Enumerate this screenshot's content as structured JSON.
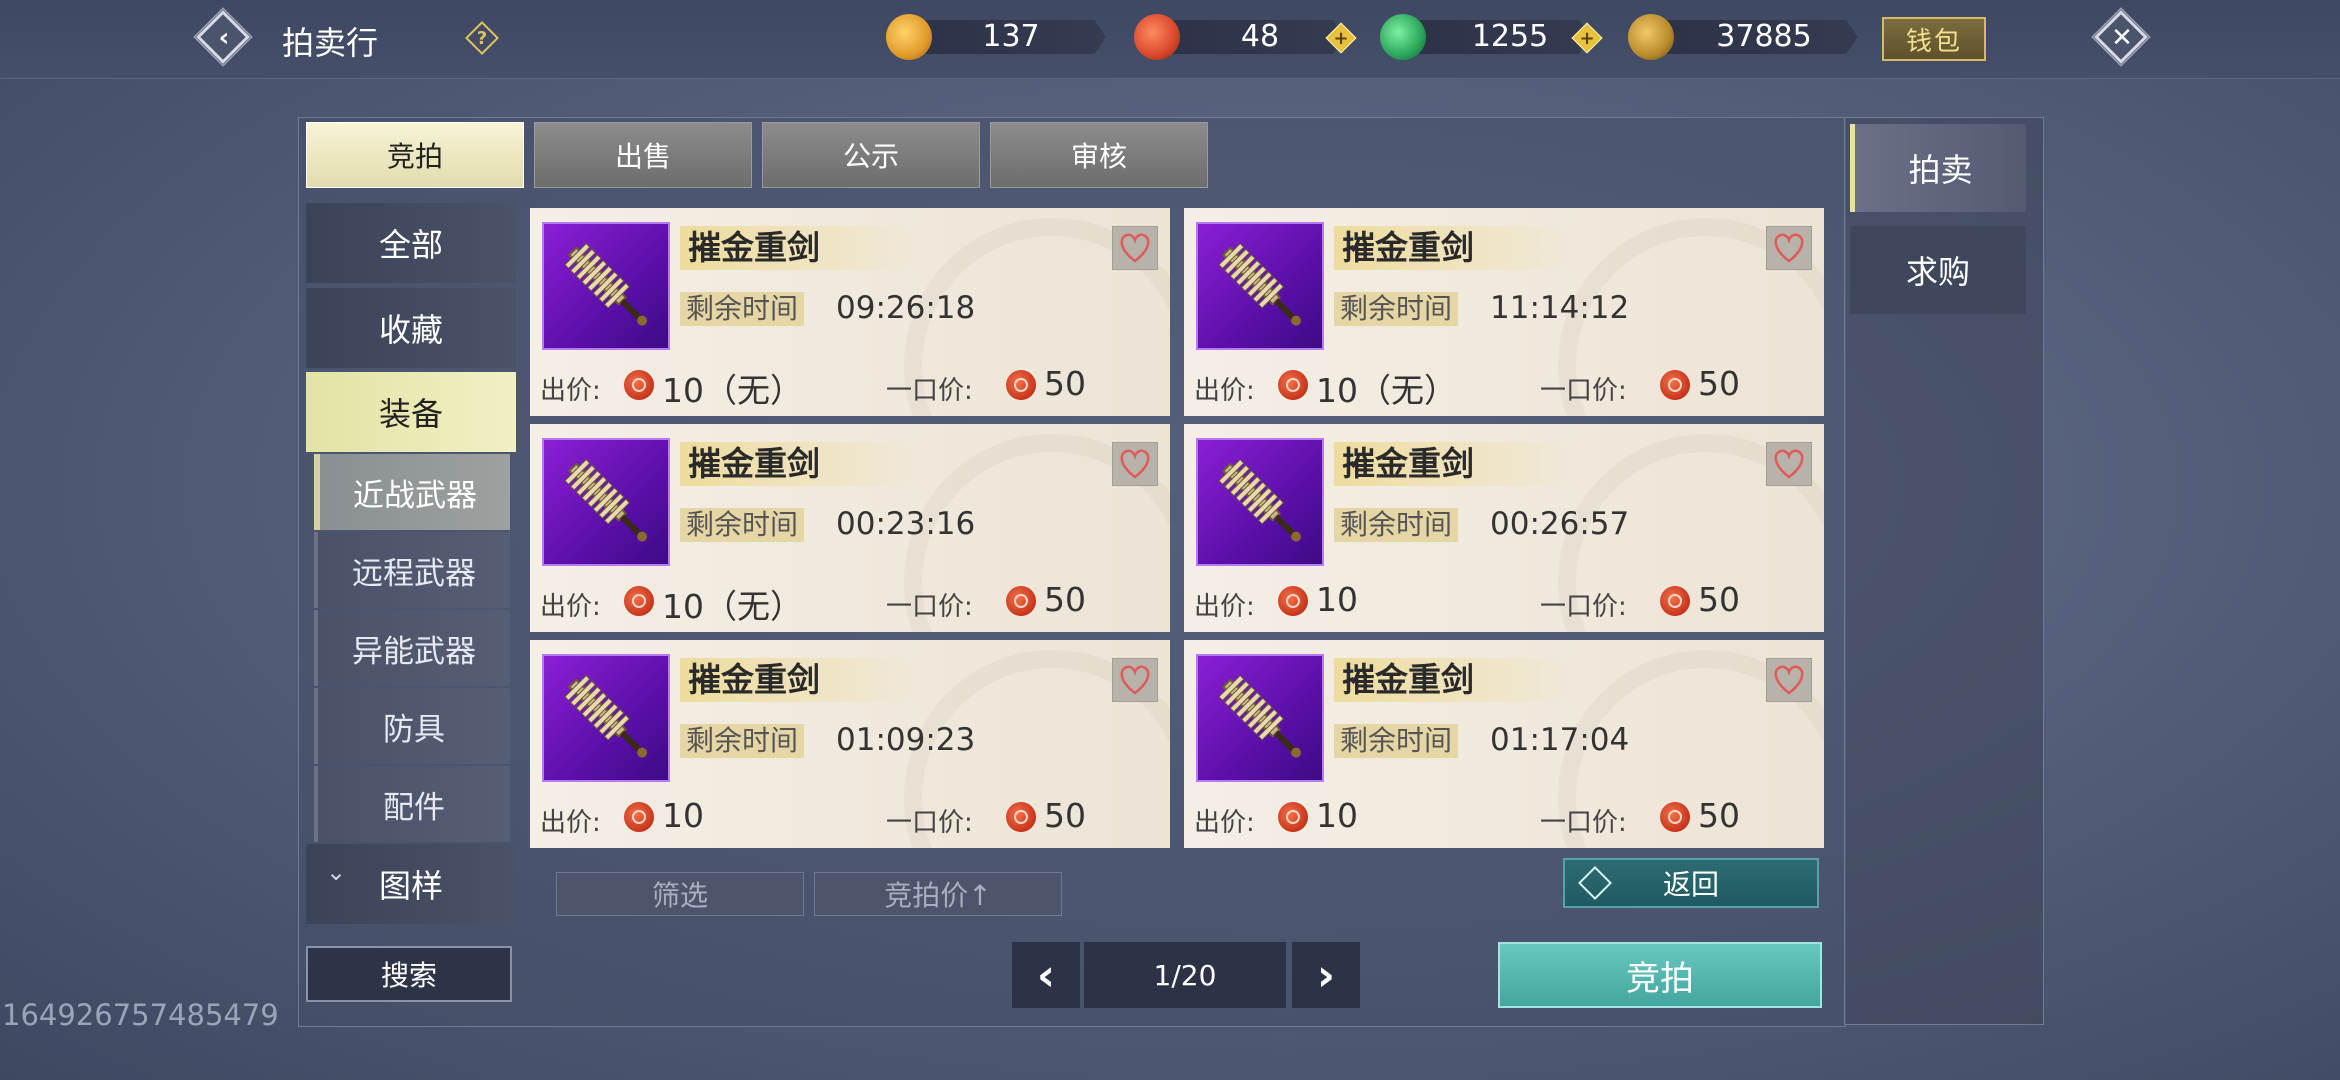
{
  "header": {
    "title": "拍卖行",
    "help_glyph": "?",
    "wallet_label": "钱包",
    "currencies": [
      {
        "name": "gold-ingot",
        "value": "137",
        "color": "#e09b2a"
      },
      {
        "name": "red-coin",
        "value": "48",
        "color": "#d9472a"
      },
      {
        "name": "jade-coin",
        "value": "1255",
        "color": "#2aa55a"
      },
      {
        "name": "copper-coin",
        "value": "37885",
        "color": "#b88a2a"
      }
    ]
  },
  "tabs": [
    "竞拍",
    "出售",
    "公示",
    "审核"
  ],
  "active_tab": "竞拍",
  "categories": {
    "all": "全部",
    "favorites": "收藏",
    "equipment": "装备",
    "subcategories": [
      "近战武器",
      "远程武器",
      "异能武器",
      "防具",
      "配件"
    ],
    "patterns": "图样",
    "patterns_arrow": "⌄"
  },
  "search_label": "搜索",
  "items": [
    {
      "name": "摧金重剑",
      "time_label": "剩余时间",
      "time": "09:26:18",
      "bid_label": "出价:",
      "bid": "10（无）",
      "buyout_label": "一口价:",
      "buyout": "50"
    },
    {
      "name": "摧金重剑",
      "time_label": "剩余时间",
      "time": "11:14:12",
      "bid_label": "出价:",
      "bid": "10（无）",
      "buyout_label": "一口价:",
      "buyout": "50"
    },
    {
      "name": "摧金重剑",
      "time_label": "剩余时间",
      "time": "00:23:16",
      "bid_label": "出价:",
      "bid": "10（无）",
      "buyout_label": "一口价:",
      "buyout": "50"
    },
    {
      "name": "摧金重剑",
      "time_label": "剩余时间",
      "time": "00:26:57",
      "bid_label": "出价:",
      "bid": "10",
      "buyout_label": "一口价:",
      "buyout": "50"
    },
    {
      "name": "摧金重剑",
      "time_label": "剩余时间",
      "time": "01:09:23",
      "bid_label": "出价:",
      "bid": "10",
      "buyout_label": "一口价:",
      "buyout": "50"
    },
    {
      "name": "摧金重剑",
      "time_label": "剩余时间",
      "time": "01:17:04",
      "bid_label": "出价:",
      "bid": "10",
      "buyout_label": "一口价:",
      "buyout": "50"
    }
  ],
  "filter_label": "筛选",
  "sort_label": "竞拍价↑",
  "back_label": "返回",
  "pager": {
    "prev": "‹",
    "page": "1/20",
    "next": "›"
  },
  "bid_button": "竞拍",
  "side_tabs": [
    "拍卖",
    "求购"
  ],
  "uid": "164926757485479"
}
